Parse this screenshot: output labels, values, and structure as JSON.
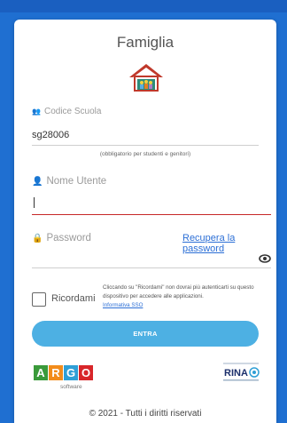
{
  "header": {
    "title": "Famiglia"
  },
  "school_code": {
    "label": "Codice Scuola",
    "value": "sg28006",
    "hint": "(obbligatorio per studenti e genitori)"
  },
  "username": {
    "label": "Nome Utente",
    "value": ""
  },
  "password": {
    "label": "Password",
    "recover_link": "Recupera la password",
    "value": ""
  },
  "remember": {
    "label": "Ricordami",
    "note": "Cliccando su \"Ricordami\" non dovrai più autenticarti su questo dispositivo per accedere alle applicazioni.",
    "note_link": "Informativa SSO",
    "checked": false
  },
  "actions": {
    "submit_label": "ENTRA"
  },
  "brands": {
    "argo_letters": [
      "A",
      "R",
      "G",
      "O"
    ],
    "argo_colors": [
      "#3a9a3a",
      "#f28c1b",
      "#2f9fd6",
      "#d8262a"
    ],
    "argo_sub": "software",
    "rina_text": "RINA"
  },
  "footer": {
    "text": "© 2021 - Tutti i diritti riservati"
  },
  "colors": {
    "accent": "#4db0e3",
    "link": "#2c6fd6",
    "focus_line": "#c62828",
    "background": "#1f6fd1"
  }
}
